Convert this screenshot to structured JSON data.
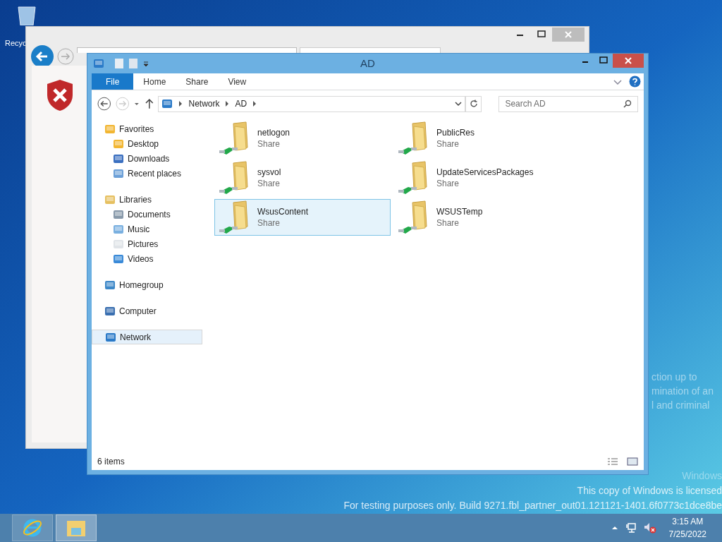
{
  "desktop": {
    "recycle_label": "Recyc",
    "watermark_lines": [
      "ction up to",
      "mination of an",
      "l and criminal"
    ],
    "license_lines": [
      "Windows",
      "This copy of Windows is licensed",
      "For testing purposes only. Build 9271.fbl_partner_out01.121121-1401.6f0773c1dce8be"
    ]
  },
  "explorer": {
    "title": "AD",
    "ribbon_tabs": [
      {
        "label": "File",
        "kind": "file"
      },
      {
        "label": "Home",
        "kind": "tab"
      },
      {
        "label": "Share",
        "kind": "tab"
      },
      {
        "label": "View",
        "kind": "tab"
      }
    ],
    "breadcrumb": [
      "Network",
      "AD"
    ],
    "search": {
      "placeholder": "Search AD"
    },
    "nav": [
      {
        "label": "Favorites",
        "selected": false,
        "children": [
          {
            "label": "Desktop",
            "selected": false
          },
          {
            "label": "Downloads",
            "selected": false
          },
          {
            "label": "Recent places",
            "selected": false
          }
        ]
      },
      {
        "label": "Libraries",
        "selected": false,
        "children": [
          {
            "label": "Documents",
            "selected": false
          },
          {
            "label": "Music",
            "selected": false
          },
          {
            "label": "Pictures",
            "selected": false
          },
          {
            "label": "Videos",
            "selected": false
          }
        ]
      },
      {
        "label": "Homegroup",
        "selected": false
      },
      {
        "label": "Computer",
        "selected": false
      },
      {
        "label": "Network",
        "selected": true
      }
    ],
    "items": [
      {
        "name": "netlogon",
        "type": "Share",
        "selected": false
      },
      {
        "name": "PublicRes",
        "type": "Share",
        "selected": false
      },
      {
        "name": "sysvol",
        "type": "Share",
        "selected": false
      },
      {
        "name": "UpdateServicesPackages",
        "type": "Share",
        "selected": false
      },
      {
        "name": "WsusContent",
        "type": "Share",
        "selected": true
      },
      {
        "name": "WSUSTemp",
        "type": "Share",
        "selected": false
      }
    ],
    "status": "6 items"
  },
  "taskbar": {
    "time": "3:15 AM",
    "date": "7/25/2022"
  }
}
